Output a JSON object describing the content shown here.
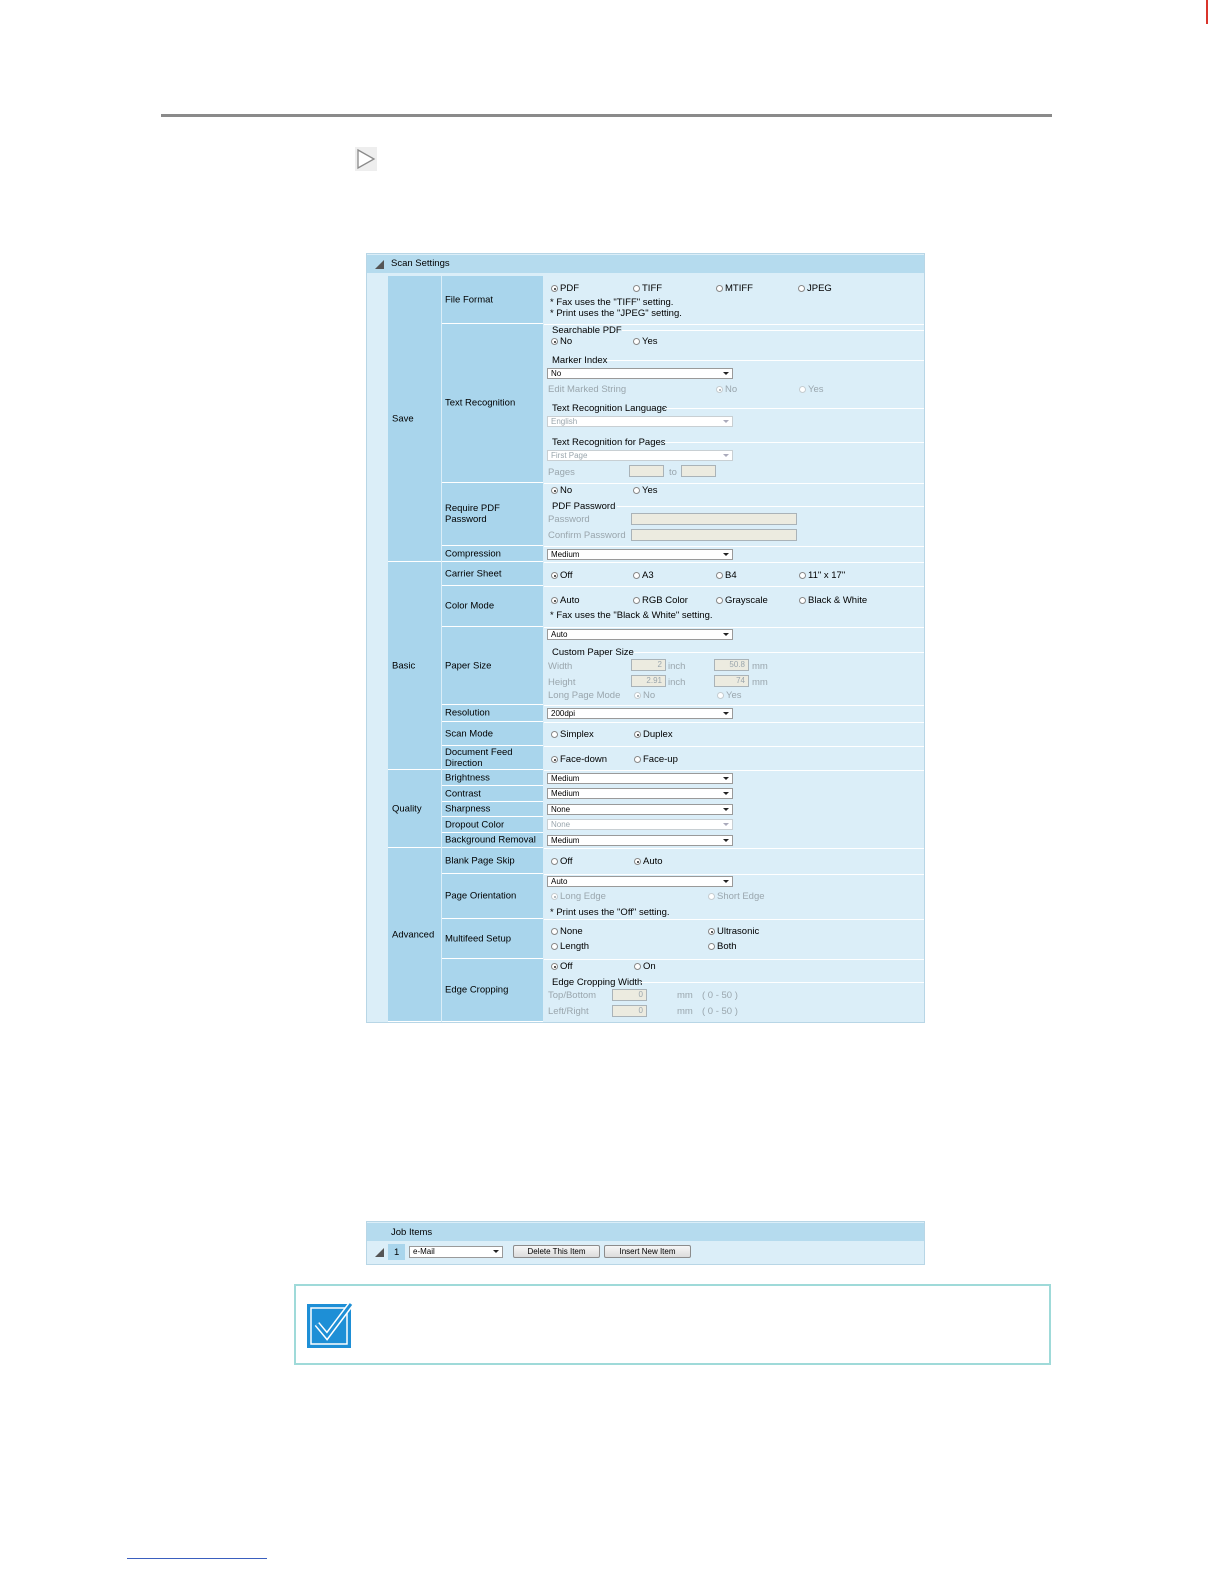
{
  "scan_settings": {
    "title": "Scan Settings",
    "save": {
      "category": "Save",
      "file_format": {
        "label": "File Format",
        "options": [
          "PDF",
          "TIFF",
          "MTIFF",
          "JPEG"
        ],
        "selected": "PDF",
        "note1": "* Fax uses the \"TIFF\" setting.",
        "note2": "* Print uses the \"JPEG\" setting."
      },
      "text_recognition": {
        "label": "Text Recognition",
        "searchable_pdf": {
          "legend": "Searchable PDF",
          "options": [
            "No",
            "Yes"
          ],
          "selected": "No"
        },
        "marker_index": {
          "legend": "Marker Index",
          "value": "No",
          "edit_label": "Edit Marked String",
          "edit_options": [
            "No",
            "Yes"
          ],
          "edit_selected": "No"
        },
        "language": {
          "legend": "Text Recognition Language",
          "value": "English"
        },
        "pages": {
          "legend": "Text Recognition for Pages",
          "value": "First Page",
          "pages_label": "Pages",
          "to_label": "to"
        }
      },
      "require_pdf_password": {
        "label": "Require PDF Password",
        "options": [
          "No",
          "Yes"
        ],
        "selected": "No",
        "legend": "PDF Password",
        "password_label": "Password",
        "confirm_label": "Confirm Password"
      },
      "compression": {
        "label": "Compression",
        "value": "Medium"
      }
    },
    "basic": {
      "category": "Basic",
      "carrier_sheet": {
        "label": "Carrier Sheet",
        "options": [
          "Off",
          "A3",
          "B4",
          "11\" x 17\""
        ],
        "selected": "Off"
      },
      "color_mode": {
        "label": "Color Mode",
        "options": [
          "Auto",
          "RGB Color",
          "Grayscale",
          "Black & White"
        ],
        "selected": "Auto",
        "note": "* Fax uses the \"Black & White\" setting."
      },
      "paper_size": {
        "label": "Paper Size",
        "value": "Auto",
        "legend": "Custom Paper Size",
        "width_label": "Width",
        "width_inch": "2",
        "width_mm": "50.8",
        "height_label": "Height",
        "height_inch": "2.91",
        "height_mm": "74",
        "inch_unit": "inch",
        "mm_unit": "mm",
        "long_page_label": "Long Page Mode",
        "long_page_options": [
          "No",
          "Yes"
        ],
        "long_page_selected": "No"
      },
      "resolution": {
        "label": "Resolution",
        "value": "200dpi"
      },
      "scan_mode": {
        "label": "Scan Mode",
        "options": [
          "Simplex",
          "Duplex"
        ],
        "selected": "Duplex"
      },
      "feed_direction": {
        "label_line1": "Document Feed",
        "label_line2": "Direction",
        "options": [
          "Face-down",
          "Face-up"
        ],
        "selected": "Face-down"
      }
    },
    "quality": {
      "category": "Quality",
      "brightness": {
        "label": "Brightness",
        "value": "Medium"
      },
      "contrast": {
        "label": "Contrast",
        "value": "Medium"
      },
      "sharpness": {
        "label": "Sharpness",
        "value": "None"
      },
      "dropout_color": {
        "label": "Dropout Color",
        "value": "None"
      },
      "background_removal": {
        "label": "Background Removal",
        "value": "Medium"
      }
    },
    "advanced": {
      "category": "Advanced",
      "blank_page_skip": {
        "label": "Blank Page Skip",
        "options": [
          "Off",
          "Auto"
        ],
        "selected": "Auto"
      },
      "page_orientation": {
        "label": "Page Orientation",
        "value": "Auto",
        "options": [
          "Long Edge",
          "Short Edge"
        ],
        "selected": "Long Edge",
        "note": "* Print uses the \"Off\" setting."
      },
      "multifeed_setup": {
        "label": "Multifeed Setup",
        "options": [
          "None",
          "Ultrasonic",
          "Length",
          "Both"
        ],
        "selected": "Ultrasonic"
      },
      "edge_cropping": {
        "label": "Edge Cropping",
        "options": [
          "Off",
          "On"
        ],
        "selected": "Off",
        "legend": "Edge Cropping Width",
        "top_bottom_label": "Top/Bottom",
        "top_bottom_value": "0",
        "left_right_label": "Left/Right",
        "left_right_value": "0",
        "unit": "mm",
        "range": "( 0 - 50 )"
      }
    }
  },
  "job_items": {
    "title": "Job Items",
    "index": "1",
    "selected_job": "e-Mail",
    "delete_button": "Delete This Item",
    "insert_button": "Insert New Item"
  },
  "colors": {
    "panel_bg": "#dbeef8",
    "label_bg": "#a9d5ec",
    "header_bg": "#b5dbee",
    "note_border": "#9fdad9",
    "check_blue": "#1e8fd6"
  }
}
